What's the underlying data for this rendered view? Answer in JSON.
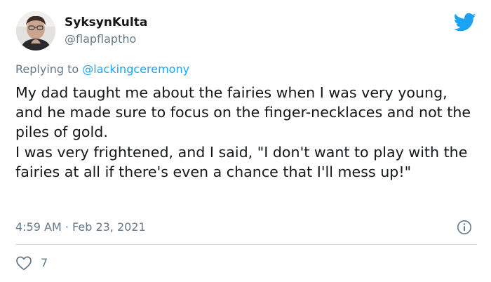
{
  "author": {
    "display_name": "SyksynKulta",
    "handle": "@flapflaptho",
    "avatar": "profile-photo"
  },
  "reply_context": {
    "prefix": "Replying to",
    "mention": "@lackingceremony"
  },
  "tweet": {
    "paragraphs": [
      "My dad taught me about the fairies when I was very young, and he made sure to focus on the finger-necklaces and not the piles of gold.",
      "I was very frightened, and I said, \"I don't want to play with the fairies at all if there's even a chance that I'll mess up!\""
    ],
    "timestamp": "4:59 AM · Feb 23, 2021"
  },
  "actions": {
    "like_count": "7",
    "like_icon": "heart-icon",
    "info_icon": "info-icon"
  },
  "brand": {
    "icon": "twitter-bird-icon",
    "color": "#1da1f2"
  },
  "colors": {
    "text": "#14171a",
    "secondary": "#657786",
    "link": "#1da1f2",
    "divider": "#ccd6dd"
  }
}
